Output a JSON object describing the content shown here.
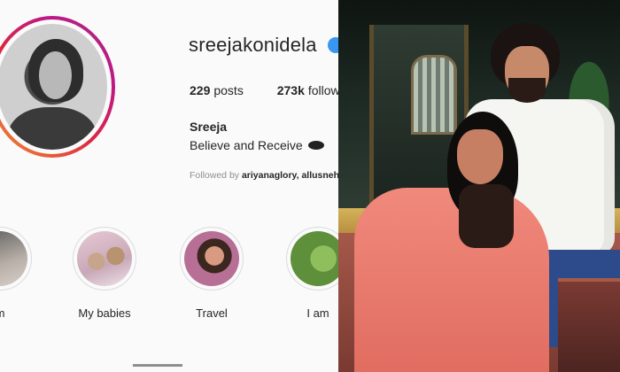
{
  "profile": {
    "username": "sreejakonidela",
    "stats": {
      "posts_count": "229",
      "posts_label": "posts",
      "followers_count": "273k",
      "followers_label": "follow"
    },
    "fullname": "Sreeja",
    "bio": "Believe and Receive",
    "followed_by": {
      "prefix": "Followed by",
      "names": "ariyanaglory, allusneh"
    },
    "highlights": [
      {
        "label": "m",
        "icon": "highlight-photo"
      },
      {
        "label": "My babies",
        "icon": "highlight-photo"
      },
      {
        "label": "Travel",
        "icon": "highlight-photo"
      },
      {
        "label": "I am",
        "icon": "highlight-photo"
      }
    ]
  }
}
